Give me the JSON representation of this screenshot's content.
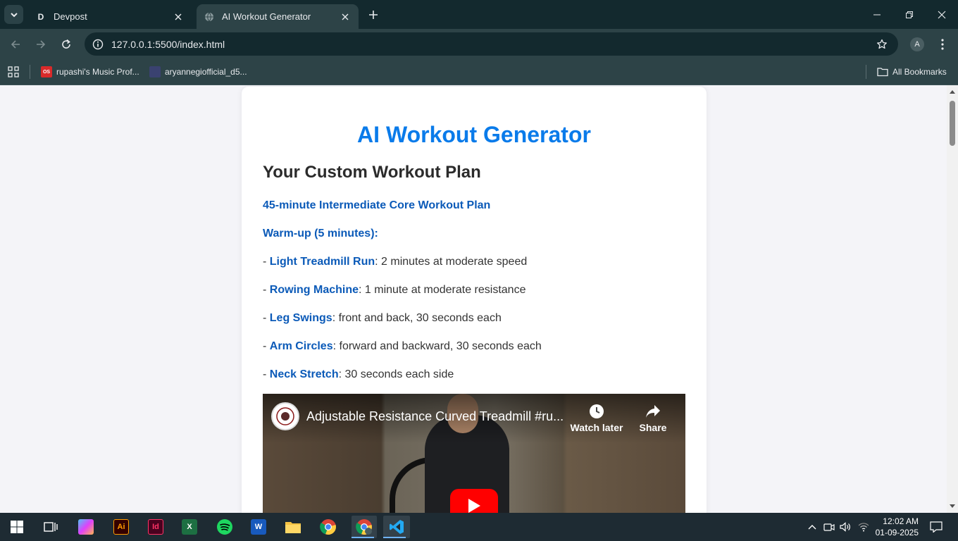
{
  "browser": {
    "tabs": [
      {
        "favicon": "D",
        "title": "Devpost"
      },
      {
        "favicon": "globe",
        "title": "AI Workout Generator"
      }
    ],
    "url": "127.0.0.1:5500/index.html",
    "profile_initial": "A",
    "bookmarks": [
      {
        "icon": "OS",
        "label": "rupashi's Music Prof..."
      },
      {
        "icon": "",
        "label": "aryannegiofficial_d5..."
      }
    ],
    "all_bookmarks_label": "All Bookmarks"
  },
  "page": {
    "title": "AI Workout Generator",
    "plan_heading": "Your Custom Workout Plan",
    "plan_name": "45-minute Intermediate Core Workout Plan",
    "warmup_label": "Warm-up (5 minutes):",
    "exercises": [
      {
        "prefix": "- ",
        "name": "Light Treadmill Run",
        "detail": ": 2 minutes at moderate speed"
      },
      {
        "prefix": "- ",
        "name": "Rowing Machine",
        "detail": ": 1 minute at moderate resistance"
      },
      {
        "prefix": "- ",
        "name": "Leg Swings",
        "detail": ": front and back, 30 seconds each"
      },
      {
        "prefix": "- ",
        "name": "Arm Circles",
        "detail": ": forward and backward, 30 seconds each"
      },
      {
        "prefix": "- ",
        "name": "Neck Stretch",
        "detail": ": 30 seconds each side"
      }
    ],
    "video": {
      "title": "Adjustable Resistance Curved Treadmill #ru...",
      "watch_later": "Watch later",
      "share": "Share"
    }
  },
  "taskbar": {
    "time": "12:02 AM",
    "date": "01-09-2025",
    "apps": [
      "windows-start",
      "task-view",
      "copilot",
      "illustrator",
      "indesign",
      "excel",
      "spotify",
      "word",
      "file-explorer",
      "chrome",
      "chrome-profile",
      "vscode"
    ]
  },
  "colors": {
    "accent_title": "#0a7bea",
    "exercise_blue": "#0b5ab8",
    "chrome_dark": "#13292e",
    "chrome_mid": "#2d4347"
  }
}
